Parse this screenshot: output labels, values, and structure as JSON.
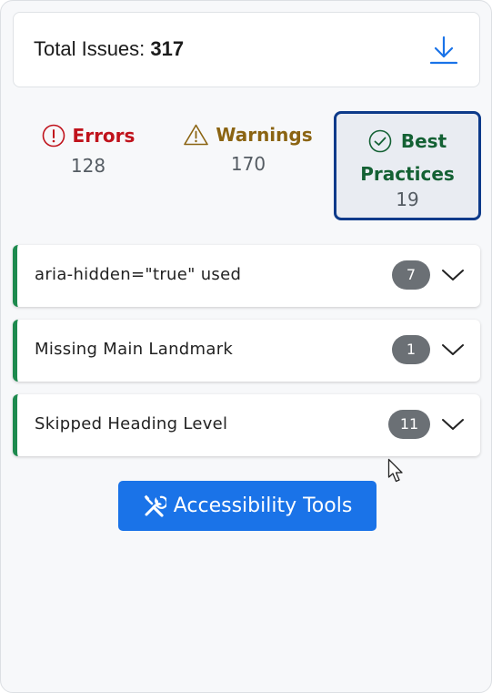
{
  "summary": {
    "label": "Total Issues:",
    "total": "317",
    "download_icon": "download-icon"
  },
  "categories": [
    {
      "label": "Errors",
      "count": "128",
      "icon": "error-circle-icon",
      "color": "#c0131c"
    },
    {
      "label": "Warnings",
      "count": "170",
      "icon": "warning-triangle-icon",
      "color": "#8b6412"
    },
    {
      "label_line1": "Best",
      "label_line2": "Practices",
      "count": "19",
      "icon": "check-circle-icon",
      "color": "#146134",
      "selected": true
    }
  ],
  "issues": [
    {
      "label": "aria-hidden=\"true\" used",
      "count": "7"
    },
    {
      "label": "Missing Main Landmark",
      "count": "1"
    },
    {
      "label": "Skipped Heading Level",
      "count": "11"
    }
  ],
  "tools_button": {
    "label": "Accessibility Tools",
    "icon": "tools-icon"
  },
  "accent_color": "#1a73e8",
  "issue_border_color": "#1d8a4e"
}
